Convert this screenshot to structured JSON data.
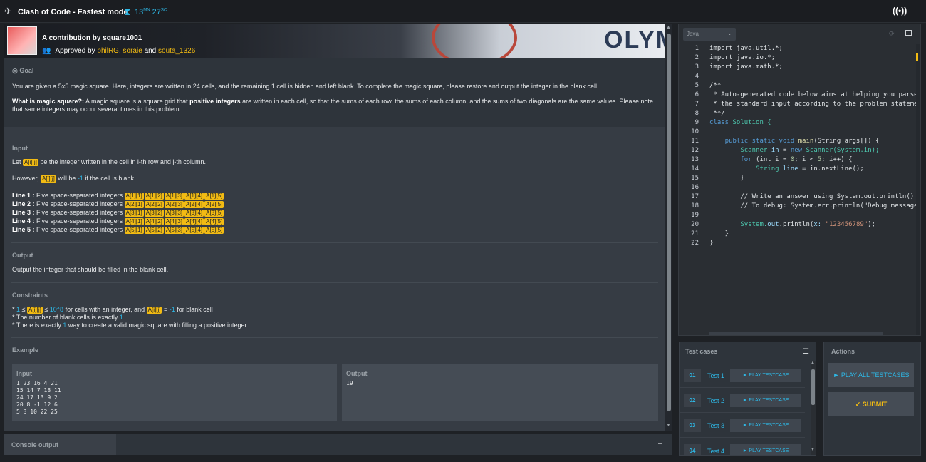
{
  "topbar": {
    "title": "Clash of Code - Fastest mode",
    "timer_min": "13",
    "timer_min_unit": "MN",
    "timer_sec": "27",
    "timer_sec_unit": "SC"
  },
  "banner": {
    "contribution": "A contribution by square1001",
    "approved_prefix": "Approved by",
    "approver1": "philRG",
    "approver2": "soraie",
    "approved_and": "and",
    "approver3": "souta_1326",
    "bg_text": "OLYM"
  },
  "goal": {
    "label": "Goal",
    "text": "You are given a 5x5 magic square. Here, integers are written in 24 cells, and the remaining 1 cell is hidden and left blank. To complete the magic square, please restore and output the integer in the blank cell.",
    "what_label": "What is magic square?:",
    "what_text_1": " A magic square is a square grid that ",
    "what_bold": "positive integers",
    "what_text_2": " are written in each cell, so that the sums of each row, the sums of each column, and the sums of two diagonals are the same values. Please note that same integers may occur several times in this problem."
  },
  "input": {
    "label": "Input",
    "let_1": "Let",
    "var": "A[i][j]",
    "let_2": "be the integer written in the cell in i-th row and j-th column.",
    "however_1": "However,",
    "however_2": "will be",
    "minus_one": "-1",
    "however_3": "if the cell is blank.",
    "lines": [
      {
        "label": "Line 1 :",
        "desc": "Five space-separated integers",
        "vars": [
          "A[1][1]",
          "A[1][2]",
          "A[1][3]",
          "A[1][4]",
          "A[1][5]"
        ]
      },
      {
        "label": "Line 2 :",
        "desc": "Five space-separated integers",
        "vars": [
          "A[2][1]",
          "A[2][2]",
          "A[2][3]",
          "A[2][4]",
          "A[2][5]"
        ]
      },
      {
        "label": "Line 3 :",
        "desc": "Five space-separated integers",
        "vars": [
          "A[3][1]",
          "A[3][2]",
          "A[3][3]",
          "A[3][4]",
          "A[3][5]"
        ]
      },
      {
        "label": "Line 4 :",
        "desc": "Five space-separated integers",
        "vars": [
          "A[4][1]",
          "A[4][2]",
          "A[4][3]",
          "A[4][4]",
          "A[4][5]"
        ]
      },
      {
        "label": "Line 5 :",
        "desc": "Five space-separated integers",
        "vars": [
          "A[5][1]",
          "A[5][2]",
          "A[5][3]",
          "A[5][4]",
          "A[5][5]"
        ]
      }
    ]
  },
  "output": {
    "label": "Output",
    "text": "Output the integer that should be filled in the blank cell."
  },
  "constraints": {
    "label": "Constraints",
    "c1_star": "*",
    "c1_one": "1",
    "c1_le1": "≤",
    "c1_var": "A[i][j]",
    "c1_le2": "≤",
    "c1_max": "10^8",
    "c1_text": "for cells with an integer, and",
    "c1_var2": "A[i][j]",
    "c1_eq": "=",
    "c1_neg": "-1",
    "c1_end": "for blank cell",
    "c2_text": "* The number of blank cells is exactly",
    "c2_val": "1",
    "c3_text_1": "* There is exactly",
    "c3_val": "1",
    "c3_text_2": "way to create a valid magic square with filling a positive integer"
  },
  "example": {
    "label": "Example",
    "input_label": "Input",
    "input_text": "1 23 16 4 21\n15 14 7 18 11\n24 17 13 9 2\n20 8 -1 12 6\n5 3 10 22 25",
    "output_label": "Output",
    "output_text": "19"
  },
  "console": {
    "label": "Console output",
    "minimize": "–"
  },
  "editor": {
    "language": "Java",
    "lines": [
      {
        "n": "1"
      },
      {
        "n": "2"
      },
      {
        "n": "3"
      },
      {
        "n": "4"
      },
      {
        "n": "5"
      },
      {
        "n": "6"
      },
      {
        "n": "7"
      },
      {
        "n": "8"
      },
      {
        "n": "9"
      },
      {
        "n": "10"
      },
      {
        "n": "11"
      },
      {
        "n": "12"
      },
      {
        "n": "13"
      },
      {
        "n": "14"
      },
      {
        "n": "15"
      },
      {
        "n": "16"
      },
      {
        "n": "17"
      },
      {
        "n": "18"
      },
      {
        "n": "19"
      },
      {
        "n": "20"
      },
      {
        "n": "21"
      },
      {
        "n": "22"
      }
    ],
    "code": {
      "l1": "import java.util.*;",
      "l2": "import java.io.*;",
      "l3": "import java.math.*;",
      "l5": "/**",
      "l6": " * Auto-generated code below aims at helping you parse",
      "l7": " * the standard input according to the problem statement.",
      "l8": " **/",
      "l9a": "class",
      "l9b": " Solution {",
      "l11a": "    public static void ",
      "l11b": "main",
      "l11c": "(String args[]) {",
      "l12a": "        Scanner ",
      "l12b": "in",
      "l12c": " = ",
      "l12d": "new",
      "l12e": " Scanner(System.in);",
      "l13a": "        for",
      "l13b": " (int i = ",
      "l13c": "0",
      "l13d": "; i < ",
      "l13e": "5",
      "l13f": "; i++) {",
      "l14a": "            String ",
      "l14b": "line",
      "l14c": " = in.nextLine();",
      "l15": "        }",
      "l17": "        // Write an answer using System.out.println()",
      "l18": "        // To debug: System.err.println(\"Debug messages...\");",
      "l20a": "        System.",
      "l20b": "out",
      "l20c": ".println(",
      "l20d": "x: ",
      "l20e": "\"123456789\"",
      "l20f": ");",
      "l21": "    }",
      "l22": "}"
    }
  },
  "tests": {
    "label": "Test cases",
    "play_label": "► PLAY TESTCASE",
    "items": [
      {
        "num": "01",
        "name": "Test 1"
      },
      {
        "num": "02",
        "name": "Test 2"
      },
      {
        "num": "03",
        "name": "Test 3"
      },
      {
        "num": "04",
        "name": "Test 4"
      }
    ]
  },
  "actions": {
    "label": "Actions",
    "play_all": "► PLAY ALL TESTCASES",
    "submit": "✓  SUBMIT"
  },
  "colors": {
    "accent_blue": "#2eb8e6",
    "accent_yellow": "#f2bb13",
    "background": "#1e2125"
  },
  "icons": [
    "rocket-icon",
    "hourglass-icon",
    "live-broadcast-icon",
    "goal-target-icon",
    "group-icon",
    "reset-icon",
    "fullscreen-icon",
    "list-icon",
    "minimize-icon"
  ]
}
